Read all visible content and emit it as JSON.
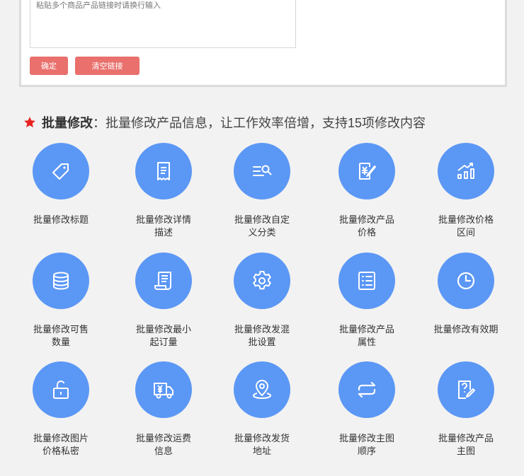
{
  "link_input": {
    "placeholder": "粘贴多个商品产品链接时请换行输入"
  },
  "buttons": {
    "confirm": "确定",
    "clear": "清空链接"
  },
  "section": {
    "title": "批量修改",
    "description": "：批量修改产品信息，让工作效率倍增，支持15项修改内容",
    "accent_color": "#e8231f"
  },
  "icon_color": "#5b97f5",
  "features": [
    {
      "label": "批量修改标题",
      "icon": "tag-icon"
    },
    {
      "label": "批量修改详情\n描述",
      "icon": "receipt-icon"
    },
    {
      "label": "批量修改自定\n义分类",
      "icon": "list-search-icon"
    },
    {
      "label": "批量修改产品\n价格",
      "icon": "price-edit-icon"
    },
    {
      "label": "批量修改价格\n区间",
      "icon": "bar-trend-icon"
    },
    {
      "label": "批量修改可售\n数量",
      "icon": "coin-stack-icon"
    },
    {
      "label": "批量修改最小\n起订量",
      "icon": "scroll-icon"
    },
    {
      "label": "批量修改发混\n批设置",
      "icon": "gear-icon"
    },
    {
      "label": "批量修改产品\n属性",
      "icon": "checklist-icon"
    },
    {
      "label": "批量修改有效期",
      "icon": "clock-icon"
    },
    {
      "label": "批量修改图片\n价格私密",
      "icon": "unlock-icon"
    },
    {
      "label": "批量修改运费\n信息",
      "icon": "truck-icon"
    },
    {
      "label": "批量修改发货\n地址",
      "icon": "location-icon"
    },
    {
      "label": "批量修改主图\n顺序",
      "icon": "swap-icon"
    },
    {
      "label": "批量修改产品\n主图",
      "icon": "question-edit-icon"
    }
  ]
}
